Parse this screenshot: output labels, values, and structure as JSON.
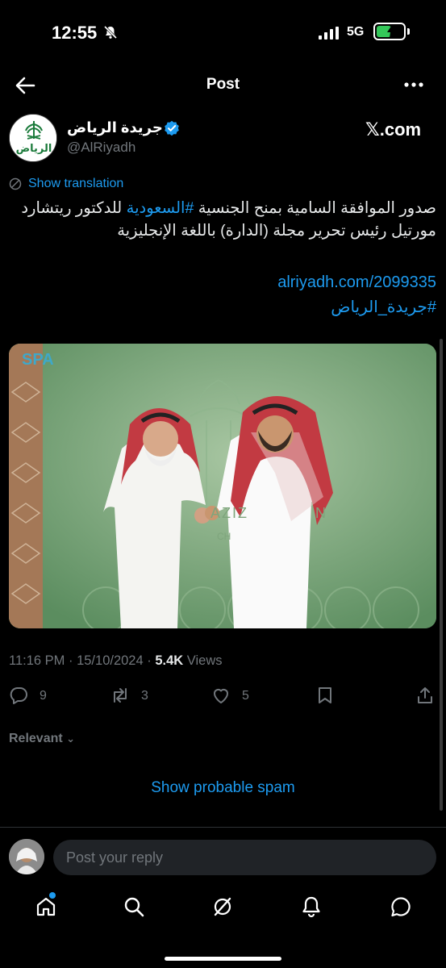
{
  "status": {
    "time": "12:55",
    "network": "5G",
    "battery_level": 0.5
  },
  "header": {
    "title": "Post"
  },
  "account": {
    "name": "جريدة الرياض",
    "handle": "@AlRiyadh",
    "avatar_text": "الرياض",
    "source": "𝕏.com"
  },
  "tweet": {
    "translate_label": "Show translation",
    "text_part1": "صدور الموافقة السامية بمنح الجنسية ",
    "hashtag1": "#السعودية",
    "text_part2": " للدكتور ريتشارد مورتيل رئيس تحرير مجلة (الدارة) باللغة الإنجليزية",
    "link": "alriyadh.com/2099335",
    "hashtag2": "#جريدة_الرياض"
  },
  "media": {
    "watermark": "SPA",
    "sign_left": "AZIZ",
    "sign_right": "N",
    "sign_bottom": "CH"
  },
  "meta": {
    "time": "11:16 PM",
    "date": "15/10/2024",
    "views_count": "5.4K",
    "views_label": "Views"
  },
  "actions": {
    "replies": "9",
    "reposts": "3",
    "likes": "5"
  },
  "replies": {
    "sort_label": "Relevant",
    "spam_label": "Show probable spam"
  },
  "composer": {
    "placeholder": "Post your reply"
  },
  "colors": {
    "accent": "#1d9bf0",
    "background": "#000000",
    "muted": "#71767b"
  }
}
